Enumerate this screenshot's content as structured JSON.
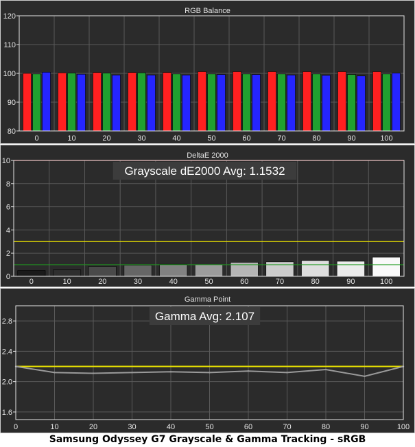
{
  "caption": "Samsung Odyssey G7 Grayscale & Gamma Tracking - sRGB",
  "colors": {
    "background": "#2b2b2b",
    "panel_border": "#cfcfcf",
    "grid": "#5a5a5a",
    "text": "#e6e6e6",
    "red": "#ff2020",
    "green": "#20a030",
    "blue": "#2525ff",
    "reference_yellow": "#e8e000",
    "reference_green": "#1f9a1f",
    "reference_red": "#ff3030",
    "gamma_line": "#9a9a9a",
    "annotation_bg": "#3c3c3c",
    "annotation_text": "#ffffff"
  },
  "chart_data": [
    {
      "type": "bar",
      "title": "RGB Balance",
      "categories": [
        "0",
        "10",
        "20",
        "30",
        "40",
        "50",
        "60",
        "70",
        "80",
        "90",
        "100"
      ],
      "ylim": [
        80,
        120
      ],
      "yticks": [
        80,
        90,
        100,
        110,
        120
      ],
      "grid": true,
      "series": [
        {
          "color": "red",
          "values": [
            100.0,
            100.2,
            100.3,
            100.3,
            100.3,
            100.6,
            100.6,
            100.6,
            100.6,
            100.6,
            100.6
          ]
        },
        {
          "color": "green",
          "values": [
            99.8,
            100.1,
            100.1,
            100.2,
            99.8,
            99.8,
            99.8,
            99.8,
            99.8,
            99.6,
            99.8
          ]
        },
        {
          "color": "blue",
          "values": [
            100.4,
            99.7,
            99.4,
            99.4,
            99.4,
            99.6,
            99.6,
            99.4,
            99.3,
            99.1,
            100.1
          ]
        }
      ]
    },
    {
      "type": "bar",
      "title": "DeltaE 2000",
      "categories": [
        "0",
        "10",
        "20",
        "30",
        "40",
        "50",
        "60",
        "70",
        "80",
        "90",
        "100"
      ],
      "values": [
        0.5,
        0.55,
        0.85,
        0.95,
        1.05,
        1.0,
        1.2,
        1.25,
        1.35,
        1.3,
        1.65
      ],
      "bar_shades": [
        "#1a1a1a",
        "#2f2f2f",
        "#4a4a4a",
        "#666666",
        "#828282",
        "#9c9c9c",
        "#b5b5b5",
        "#cccccc",
        "#dedede",
        "#ececec",
        "#f9f9f9"
      ],
      "ylim": [
        0,
        10
      ],
      "yticks": [
        0,
        2,
        4,
        6,
        8,
        10
      ],
      "reference_lines": [
        1,
        3,
        10
      ],
      "grid": true,
      "annotation": "Grayscale dE2000 Avg: 1.1532"
    },
    {
      "type": "line",
      "title": "Gamma Point",
      "x": [
        0,
        10,
        20,
        30,
        40,
        50,
        60,
        70,
        80,
        90,
        100
      ],
      "values": [
        2.2,
        2.12,
        2.11,
        2.12,
        2.13,
        2.12,
        2.14,
        2.12,
        2.16,
        2.07,
        2.2
      ],
      "reference_value": 2.2,
      "ylim": [
        1.5,
        3.0
      ],
      "yticks": [
        1.6,
        2.0,
        2.4,
        2.8
      ],
      "xlim": [
        0,
        100
      ],
      "xticks": [
        0,
        10,
        20,
        30,
        40,
        50,
        60,
        70,
        80,
        90,
        100
      ],
      "grid": true,
      "annotation": "Gamma Avg: 2.107"
    }
  ]
}
